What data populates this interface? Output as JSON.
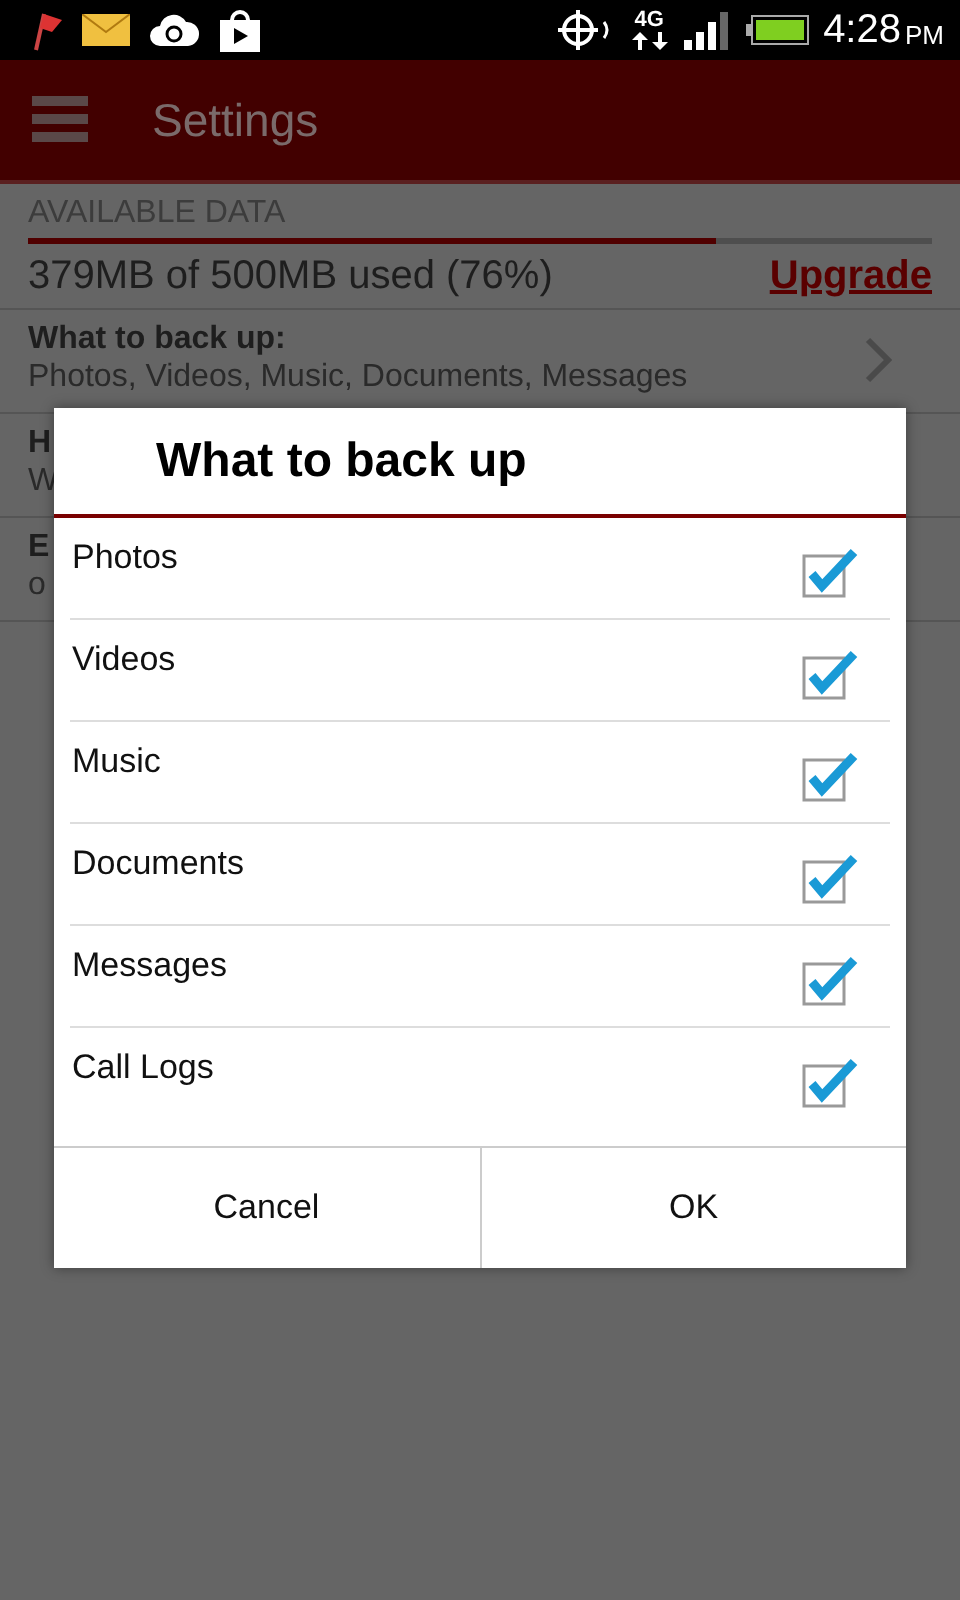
{
  "status_bar": {
    "network": "4G",
    "time": "4:28",
    "ampm": "PM"
  },
  "app_bar": {
    "title": "Settings"
  },
  "available_data": {
    "header": "AVAILABLE DATA",
    "level": 0.76,
    "usage": "379MB of 500MB used (76%)",
    "link": "Upgrade"
  },
  "settings": [
    {
      "title": "What to back up:",
      "value": "Photos, Videos, Music, Documents, Messages",
      "chevron": true
    },
    {
      "title": "H",
      "value": "W"
    },
    {
      "title": "E",
      "value": "o"
    }
  ],
  "dialog": {
    "title": "What to back up",
    "options": [
      {
        "label": "Photos",
        "checked": true
      },
      {
        "label": "Videos",
        "checked": true
      },
      {
        "label": "Music",
        "checked": true
      },
      {
        "label": "Documents",
        "checked": true
      },
      {
        "label": "Messages",
        "checked": true
      },
      {
        "label": "Call Logs",
        "checked": true
      }
    ],
    "buttons": [
      "Cancel",
      "OK"
    ]
  }
}
